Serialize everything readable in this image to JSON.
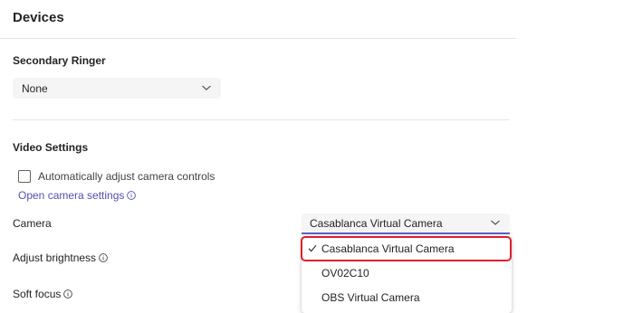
{
  "page": {
    "title": "Devices"
  },
  "secondary_ringer": {
    "title": "Secondary Ringer",
    "selected": "None"
  },
  "video_settings": {
    "title": "Video Settings",
    "auto_adjust_label": "Automatically adjust camera controls",
    "auto_adjust_checked": false,
    "open_camera_settings_link": "Open camera settings",
    "camera_label": "Camera",
    "camera_selected": "Casablanca Virtual Camera",
    "adjust_brightness_label": "Adjust brightness",
    "soft_focus_label": "Soft focus"
  },
  "camera_dropdown": {
    "options": [
      "Casablanca Virtual Camera",
      "OV02C10",
      "OBS Virtual Camera"
    ],
    "selected_index": 0
  },
  "colors": {
    "accent": "#5b5fc7",
    "link": "#4f52b2",
    "highlight": "#e0202d"
  }
}
